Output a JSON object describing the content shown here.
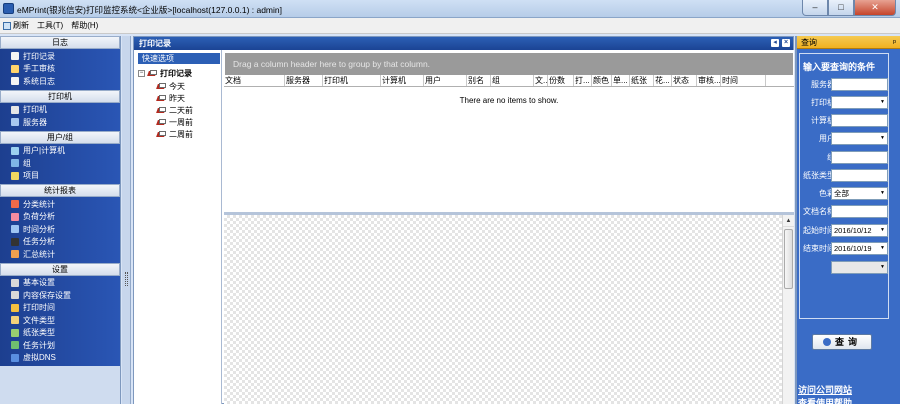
{
  "window": {
    "title": "eMPrint(银兆信安)打印监控系统<企业版>[localhost(127.0.0.1) : admin]",
    "minimize": "–",
    "maximize": "□",
    "close": "✕"
  },
  "menu": [
    "刷新",
    "工具(T)",
    "帮助(H)"
  ],
  "sidebar": {
    "sections": [
      {
        "title": "日志",
        "items": [
          {
            "label": "打印记录",
            "icon": "print-log-icon",
            "color": "#f4f4f4"
          },
          {
            "label": "手工审核",
            "icon": "manual-review-icon",
            "color": "#ffd36b"
          },
          {
            "label": "系统日志",
            "icon": "system-log-icon",
            "color": "#f4f4f4"
          }
        ]
      },
      {
        "title": "打印机",
        "items": [
          {
            "label": "打印机",
            "icon": "printer-icon",
            "color": "#e6e6e6"
          },
          {
            "label": "服务器",
            "icon": "server-icon",
            "color": "#a9c8ef"
          }
        ]
      },
      {
        "title": "用户/组",
        "items": [
          {
            "label": "用户|计算机",
            "icon": "user-computer-icon",
            "color": "#9bd0f0"
          },
          {
            "label": "组",
            "icon": "group-icon",
            "color": "#7fb6e6"
          },
          {
            "label": "项目",
            "icon": "project-icon",
            "color": "#f0d860"
          }
        ]
      },
      {
        "title": "统计报表",
        "items": [
          {
            "label": "分类统计",
            "icon": "category-stats-icon",
            "color": "#f06a4a"
          },
          {
            "label": "负荷分析",
            "icon": "load-analysis-icon",
            "color": "#f58ca0"
          },
          {
            "label": "时间分析",
            "icon": "time-analysis-icon",
            "color": "#9ec4f2"
          },
          {
            "label": "任务分析",
            "icon": "task-analysis-icon",
            "color": "#333333"
          },
          {
            "label": "汇总统计",
            "icon": "summary-stats-icon",
            "color": "#f0a050"
          }
        ]
      },
      {
        "title": "设置",
        "items": [
          {
            "label": "基本设置",
            "icon": "basic-settings-icon",
            "color": "#d8d8d8"
          },
          {
            "label": "内容保存设置",
            "icon": "content-save-settings-icon",
            "color": "#d8d8d8"
          },
          {
            "label": "打印时间",
            "icon": "print-time-icon",
            "color": "#f5c040"
          },
          {
            "label": "文件类型",
            "icon": "file-type-icon",
            "color": "#f3d27a"
          },
          {
            "label": "纸张类型",
            "icon": "paper-type-icon",
            "color": "#9ad070"
          },
          {
            "label": "任务计划",
            "icon": "task-plan-icon",
            "color": "#6fbf6f"
          },
          {
            "label": "虚拟DNS",
            "icon": "virtual-dns-icon",
            "color": "#5a8fe0"
          }
        ]
      }
    ]
  },
  "doc": {
    "title": "打印记录"
  },
  "tree": {
    "title": "快速选项",
    "root": "打印记录",
    "toggle": "−",
    "children": [
      "今天",
      "昨天",
      "二天前",
      "一周前",
      "二周前"
    ]
  },
  "grid": {
    "group_hint": "Drag a column header here to group by that column.",
    "columns": [
      "文档",
      "服务器",
      "打印机",
      "计算机",
      "用户",
      "别名",
      "组",
      "文...",
      "份数",
      "打...",
      "颜色",
      "单...",
      "纸张",
      "花...",
      "状态",
      "审核...",
      "时间"
    ],
    "empty_text": "There are no items to show."
  },
  "query": {
    "panel_title": "查询",
    "pin": "ᵖ",
    "form_title": "输入要查询的条件",
    "fields": [
      {
        "label": "服务器",
        "value": "",
        "type": "text"
      },
      {
        "label": "打印机",
        "value": "",
        "type": "select"
      },
      {
        "label": "计算机",
        "value": "",
        "type": "text"
      },
      {
        "label": "用户",
        "value": "",
        "type": "select"
      },
      {
        "label": "组",
        "value": "",
        "type": "text"
      },
      {
        "label": "纸张类型",
        "value": "",
        "type": "text"
      },
      {
        "label": "色彩",
        "value": "全部",
        "type": "select"
      },
      {
        "label": "文档名称",
        "value": "",
        "type": "text"
      },
      {
        "label": "起始时间",
        "value": "2016/10/12",
        "type": "select"
      },
      {
        "label": "结束时间",
        "value": "2016/10/19",
        "type": "select"
      },
      {
        "label": "",
        "value": "",
        "type": "select"
      }
    ],
    "button": "查询",
    "links": [
      "访问公司网站",
      "查看使用帮助"
    ]
  }
}
